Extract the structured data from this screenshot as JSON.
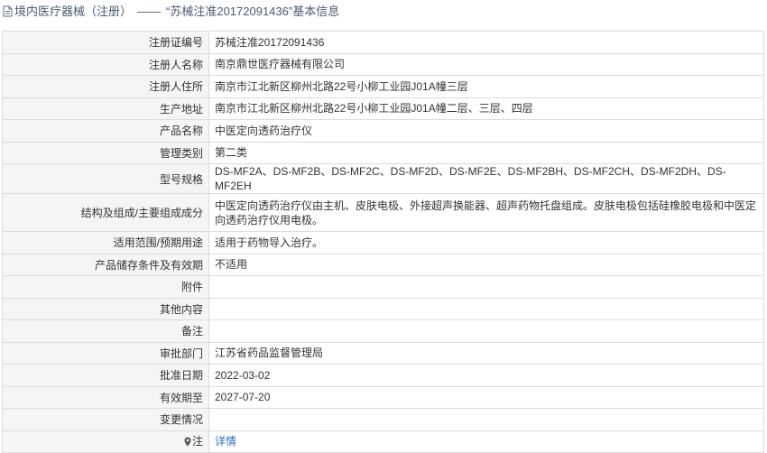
{
  "header": {
    "prefix": "境内医疗器械（注册）",
    "separator": "——",
    "subject": "“苏械注准20172091436”基本信息"
  },
  "rows": [
    {
      "label": "注册证编号",
      "value": "苏械注准20172091436"
    },
    {
      "label": "注册人名称",
      "value": "南京鼎世医疗器械有限公司"
    },
    {
      "label": "注册人住所",
      "value": "南京市江北新区柳州北路22号小柳工业园J01A幢三层"
    },
    {
      "label": "生产地址",
      "value": "南京市江北新区柳州北路22号小柳工业园J01A幢二层、三层、四层"
    },
    {
      "label": "产品名称",
      "value": "中医定向透药治疗仪"
    },
    {
      "label": "管理类别",
      "value": "第二类"
    },
    {
      "label": "型号规格",
      "value": "DS-MF2A、DS-MF2B、DS-MF2C、DS-MF2D、DS-MF2E、DS-MF2BH、DS-MF2CH、DS-MF2DH、DS-MF2EH"
    },
    {
      "label": "结构及组成/主要组成成分",
      "value": "中医定向透药治疗仪由主机、皮肤电极、外接超声换能器、超声药物托盘组成。皮肤电极包括硅橡胶电极和中医定向透药治疗仪用电极。"
    },
    {
      "label": "适用范围/预期用途",
      "value": "适用于药物导入治疗。"
    },
    {
      "label": "产品储存条件及有效期",
      "value": "不适用"
    },
    {
      "label": "附件",
      "value": ""
    },
    {
      "label": "其他内容",
      "value": ""
    },
    {
      "label": "备注",
      "value": ""
    },
    {
      "label": "审批部门",
      "value": "江苏省药品监督管理局"
    },
    {
      "label": "批准日期",
      "value": "2022-03-02"
    },
    {
      "label": "有效期至",
      "value": "2027-07-20"
    },
    {
      "label": "变更情况",
      "value": ""
    }
  ],
  "note_row": {
    "label": "注",
    "link": "详情"
  },
  "icons": {
    "header": "document-icon",
    "note": "map-pin-icon"
  },
  "colors": {
    "link": "#2a6fc9",
    "label_bg": "#f5f5f5",
    "border": "#dcdcdc",
    "title": "#4a5a75"
  }
}
